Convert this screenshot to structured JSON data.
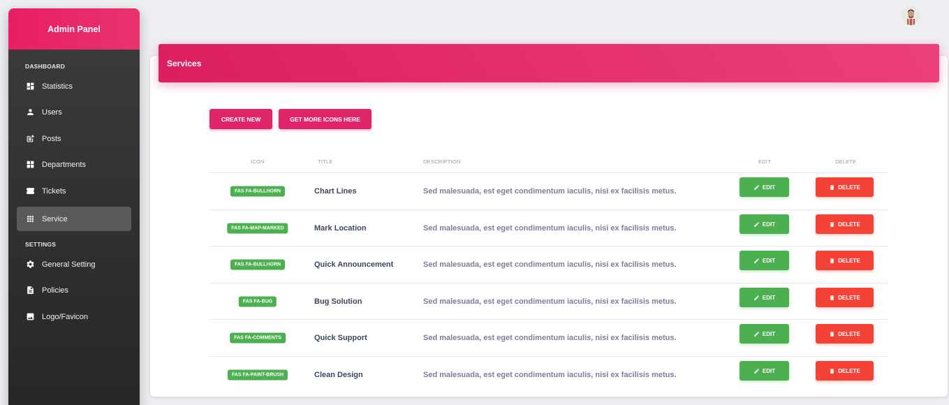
{
  "sidebar": {
    "title": "Admin Panel",
    "sections": {
      "dashboard": "DASHBOARD",
      "settings": "SETTINGS"
    },
    "items": [
      {
        "label": "Statistics",
        "icon": "dashboard-icon"
      },
      {
        "label": "Users",
        "icon": "person-icon"
      },
      {
        "label": "Posts",
        "icon": "post-add-icon"
      },
      {
        "label": "Departments",
        "icon": "dashboard-icon"
      },
      {
        "label": "Tickets",
        "icon": "ticket-icon"
      },
      {
        "label": "Service",
        "icon": "grid-icon",
        "active": true
      },
      {
        "label": "General Setting",
        "icon": "gear-icon"
      },
      {
        "label": "Policies",
        "icon": "document-icon"
      },
      {
        "label": "Logo/Favicon",
        "icon": "image-icon"
      }
    ]
  },
  "header": {
    "title": "Services"
  },
  "toolbar": {
    "create_label": "CREATE NEW",
    "icons_label": "GET MORE ICONS HERE"
  },
  "table": {
    "columns": [
      "ICON",
      "TITLE",
      "DESCRIPTION",
      "EDIT",
      "DELETE"
    ],
    "edit_label": "EDIT",
    "delete_label": "DELETE",
    "rows": [
      {
        "icon": "FAS FA-BULLHORN",
        "title": "Chart Lines",
        "description": "Sed malesuada, est eget condimentum iaculis, nisi ex facilisis metus."
      },
      {
        "icon": "FAS FA-MAP-MARKED",
        "title": "Mark Location",
        "description": "Sed malesuada, est eget condimentum iaculis, nisi ex facilisis metus."
      },
      {
        "icon": "FAS FA-BULLHORN",
        "title": "Quick Announcement",
        "description": "Sed malesuada, est eget condimentum iaculis, nisi ex facilisis metus."
      },
      {
        "icon": "FAS FA-BUG",
        "title": "Bug Solution",
        "description": "Sed malesuada, est eget condimentum iaculis, nisi ex facilisis metus."
      },
      {
        "icon": "FAS FA-COMMENTS",
        "title": "Quick Support",
        "description": "Sed malesuada, est eget condimentum iaculis, nisi ex facilisis metus."
      },
      {
        "icon": "FAS FA-PAINT-BRUSH",
        "title": "Clean Design",
        "description": "Sed malesuada, est eget condimentum iaculis, nisi ex facilisis metus."
      }
    ]
  },
  "colors": {
    "accent": "#e91e63",
    "success": "#4caf50",
    "danger": "#f44336",
    "sidebar": "#3c3c3e"
  }
}
